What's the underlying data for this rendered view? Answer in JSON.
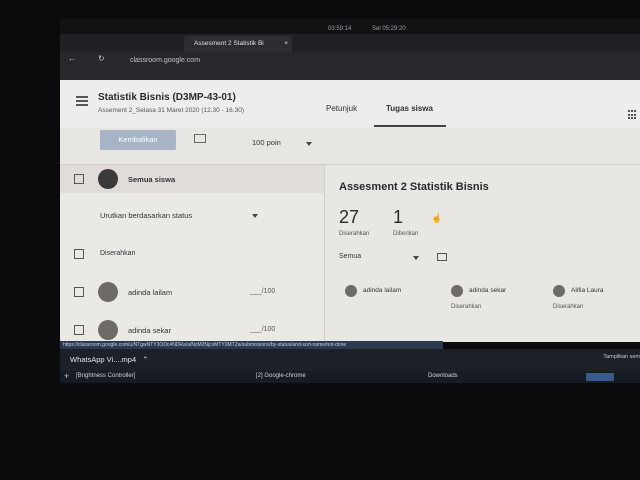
{
  "os": {
    "clock": "03:59:14",
    "date": "Sel 05:29:20"
  },
  "browser": {
    "tab_title": "Assesment 2 Statistik Bi",
    "tab_close": "×",
    "url": "classroom.google.com",
    "status_url": "https://classroom.google.com/u/NTgwNTY3ODc4NDRa/a/NzM2NjcxMTY0MTZa/submissions/by-status/and-sort-name/not-done"
  },
  "header": {
    "title": "Statistik Bisnis (D3MP-43-01)",
    "subtitle": "Assement 2_Selasa 31 Maret 2020 (12.30 - 16.30)",
    "tabs": [
      {
        "label": "Petunjuk"
      },
      {
        "label": "Tugas siswa"
      }
    ]
  },
  "toolbar": {
    "return_label": "Kembalikan",
    "points_label": "100 poin"
  },
  "left": {
    "all_students": "Semua siswa",
    "sort_label": "Urutkan berdasarkan status",
    "section_label": "Diserahkan",
    "students": [
      {
        "name": "adinda lailam",
        "score": "___/100"
      },
      {
        "name": "adinda sekar",
        "score": "___/100"
      }
    ]
  },
  "right": {
    "assignment_title": "Assesment 2 Statistik Bisnis",
    "turned_in_count": "27",
    "turned_in_label": "Diserahkan",
    "assigned_count": "1",
    "assigned_label": "Diberikan",
    "filter_label": "Semua",
    "students": [
      {
        "name": "adinda lailam",
        "status": ""
      },
      {
        "name": "adinda sekar",
        "status": "Diserahkan"
      },
      {
        "name": "Alifia Laura",
        "status": "Diserahkan"
      }
    ]
  },
  "downloads": {
    "file": "WhatsApp Vi....mp4",
    "right": "Tampilkan sem"
  },
  "taskbar": {
    "items": [
      "[Brightness Controller]",
      "[2] Google-chrome",
      "Downloads"
    ]
  }
}
